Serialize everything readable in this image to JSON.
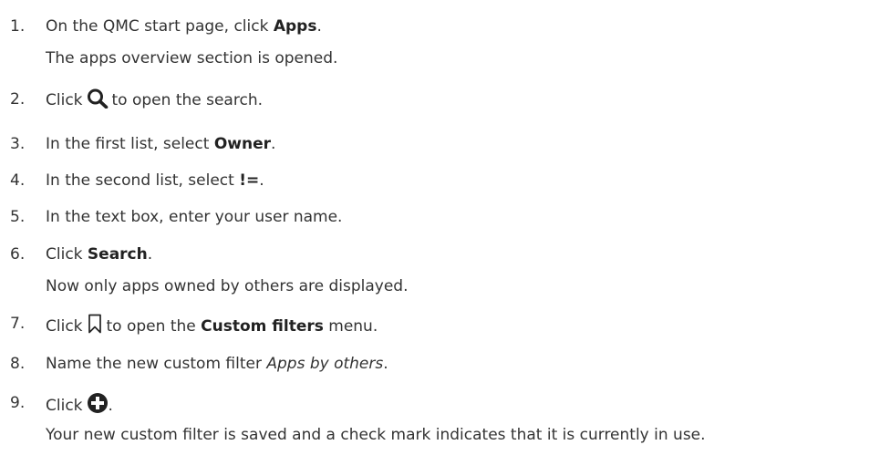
{
  "steps": [
    {
      "number": "1.",
      "line1": {
        "before": "On the QMC start page, click ",
        "strong": "Apps",
        "after": "."
      },
      "line2": "The apps overview section is opened."
    },
    {
      "number": "2.",
      "line1": {
        "before": "Click",
        "icon": "search-icon",
        "after": "to open the search."
      }
    },
    {
      "number": "3.",
      "line1": {
        "before": "In the first list, select ",
        "strong": "Owner",
        "after": "."
      }
    },
    {
      "number": "4.",
      "line1": {
        "before": "In the second list, select ",
        "strong": "!=",
        "after": "."
      }
    },
    {
      "number": "5.",
      "line1": {
        "text": "In the text box, enter your user name."
      }
    },
    {
      "number": "6.",
      "line1": {
        "before": "Click ",
        "strong": "Search",
        "after": "."
      },
      "line2": "Now only apps owned by others are displayed."
    },
    {
      "number": "7.",
      "line1": {
        "before": "Click",
        "icon": "bookmark-icon",
        "after_before_strong": "to open the ",
        "strong": "Custom filters",
        "after": " menu."
      }
    },
    {
      "number": "8.",
      "line1": {
        "before": "Name the new custom filter ",
        "italic": "Apps by others",
        "after": "."
      }
    },
    {
      "number": "9.",
      "line1": {
        "before": "Click",
        "icon": "add-circle-icon",
        "after": "."
      },
      "line2": "Your new custom filter is saved and a check mark indicates that it is currently in use."
    }
  ]
}
